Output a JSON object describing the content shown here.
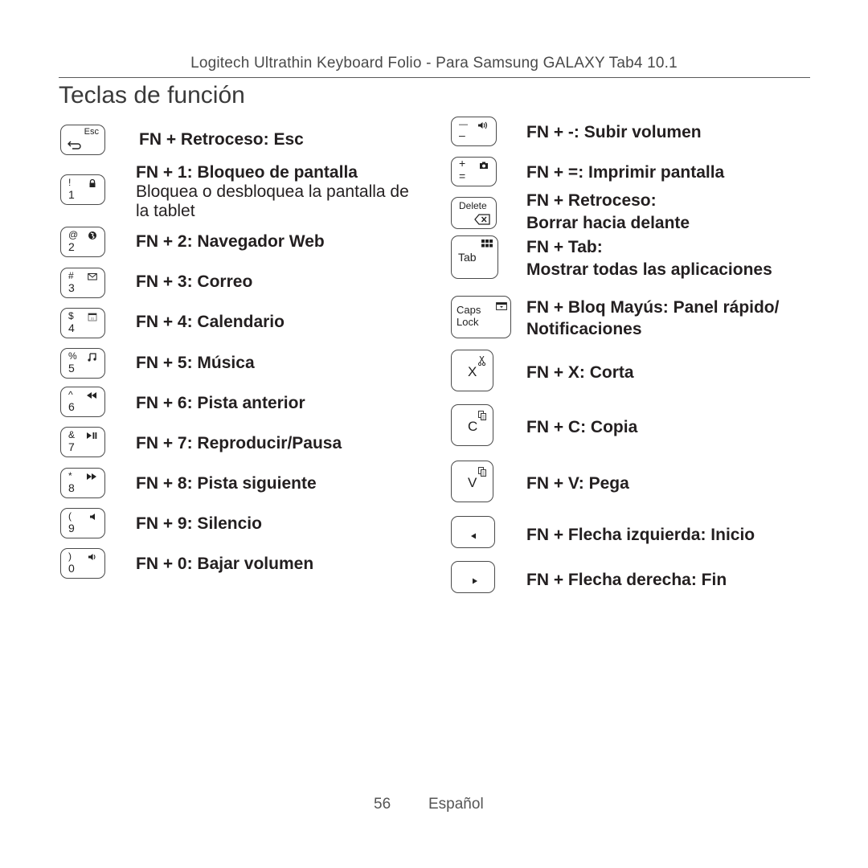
{
  "header": {
    "running_title": "Logitech Ultrathin Keyboard Folio - Para Samsung GALAXY Tab4 10.1",
    "page_title": "Teclas de función"
  },
  "left_column": [
    {
      "key": {
        "top": "Esc",
        "bottom": "",
        "icon": "back-arrow-icon"
      },
      "title": "FN + Retroceso: Esc",
      "detail": ""
    },
    {
      "key": {
        "top": "!",
        "bottom": "1",
        "icon": "lock-icon"
      },
      "title": "FN + 1: Bloqueo de pantalla",
      "detail": "Bloquea o desbloquea la pantalla de la tablet"
    },
    {
      "key": {
        "top": "@",
        "bottom": "2",
        "icon": "globe-icon"
      },
      "title": "FN + 2: Navegador Web",
      "detail": ""
    },
    {
      "key": {
        "top": "#",
        "bottom": "3",
        "icon": "envelope-icon"
      },
      "title": "FN + 3: Correo",
      "detail": ""
    },
    {
      "key": {
        "top": "$",
        "bottom": "4",
        "icon": "calendar-icon"
      },
      "title": "FN + 4: Calendario",
      "detail": ""
    },
    {
      "key": {
        "top": "%",
        "bottom": "5",
        "icon": "music-note-icon"
      },
      "title": "FN + 5: Música",
      "detail": ""
    },
    {
      "key": {
        "top": "^",
        "bottom": "6",
        "icon": "previous-track-icon"
      },
      "title": "FN + 6: Pista anterior",
      "detail": ""
    },
    {
      "key": {
        "top": "&",
        "bottom": "7",
        "icon": "play-pause-icon"
      },
      "title": "FN + 7: Reproducir/Pausa",
      "detail": ""
    },
    {
      "key": {
        "top": "*",
        "bottom": "8",
        "icon": "next-track-icon"
      },
      "title": "FN + 8: Pista siguiente",
      "detail": ""
    },
    {
      "key": {
        "top": "(",
        "bottom": "9",
        "icon": "mute-icon"
      },
      "title": "FN + 9: Silencio",
      "detail": ""
    },
    {
      "key": {
        "top": ")",
        "bottom": "0",
        "icon": "volume-down-icon"
      },
      "title": "FN + 0: Bajar volumen",
      "detail": ""
    }
  ],
  "right_column": [
    {
      "key": {
        "top": "—",
        "bottom": "–",
        "icon": "volume-up-icon"
      },
      "title": "FN + -: Subir volumen",
      "detail": ""
    },
    {
      "key": {
        "top": "+",
        "bottom": "=",
        "icon": "camera-icon"
      },
      "title": "FN + =: Imprimir pantalla",
      "detail": ""
    },
    {
      "key": {
        "top": "Delete",
        "bottom": "",
        "icon": "backspace-icon"
      },
      "title": "FN + Retroceso:",
      "detail": "Borrar hacia delante"
    },
    {
      "key": {
        "top": "",
        "bottom": "Tab",
        "icon": "app-grid-icon"
      },
      "title": "FN + Tab:",
      "detail": "Mostrar todas las aplicaciones"
    },
    {
      "key": {
        "top": "Caps",
        "bottom": "Lock",
        "icon": "notification-panel-icon"
      },
      "title": "FN + Bloq Mayús: Panel rápido/",
      "detail": "Notificaciones"
    },
    {
      "key": {
        "top": "",
        "bottom": "X",
        "icon": "scissors-icon"
      },
      "title": "FN + X: Corta",
      "detail": ""
    },
    {
      "key": {
        "top": "",
        "bottom": "C",
        "icon": "copy-icon"
      },
      "title": "FN + C: Copia",
      "detail": ""
    },
    {
      "key": {
        "top": "",
        "bottom": "V",
        "icon": "paste-icon"
      },
      "title": "FN + V: Pega",
      "detail": ""
    },
    {
      "key": {
        "top": "",
        "bottom": "",
        "icon": "left-arrow-icon"
      },
      "title": "FN + Flecha izquierda: Inicio",
      "detail": ""
    },
    {
      "key": {
        "top": "",
        "bottom": "",
        "icon": "right-arrow-icon"
      },
      "title": "FN + Flecha derecha: Fin",
      "detail": ""
    }
  ],
  "footer": {
    "page_number": "56",
    "language": "Español"
  }
}
